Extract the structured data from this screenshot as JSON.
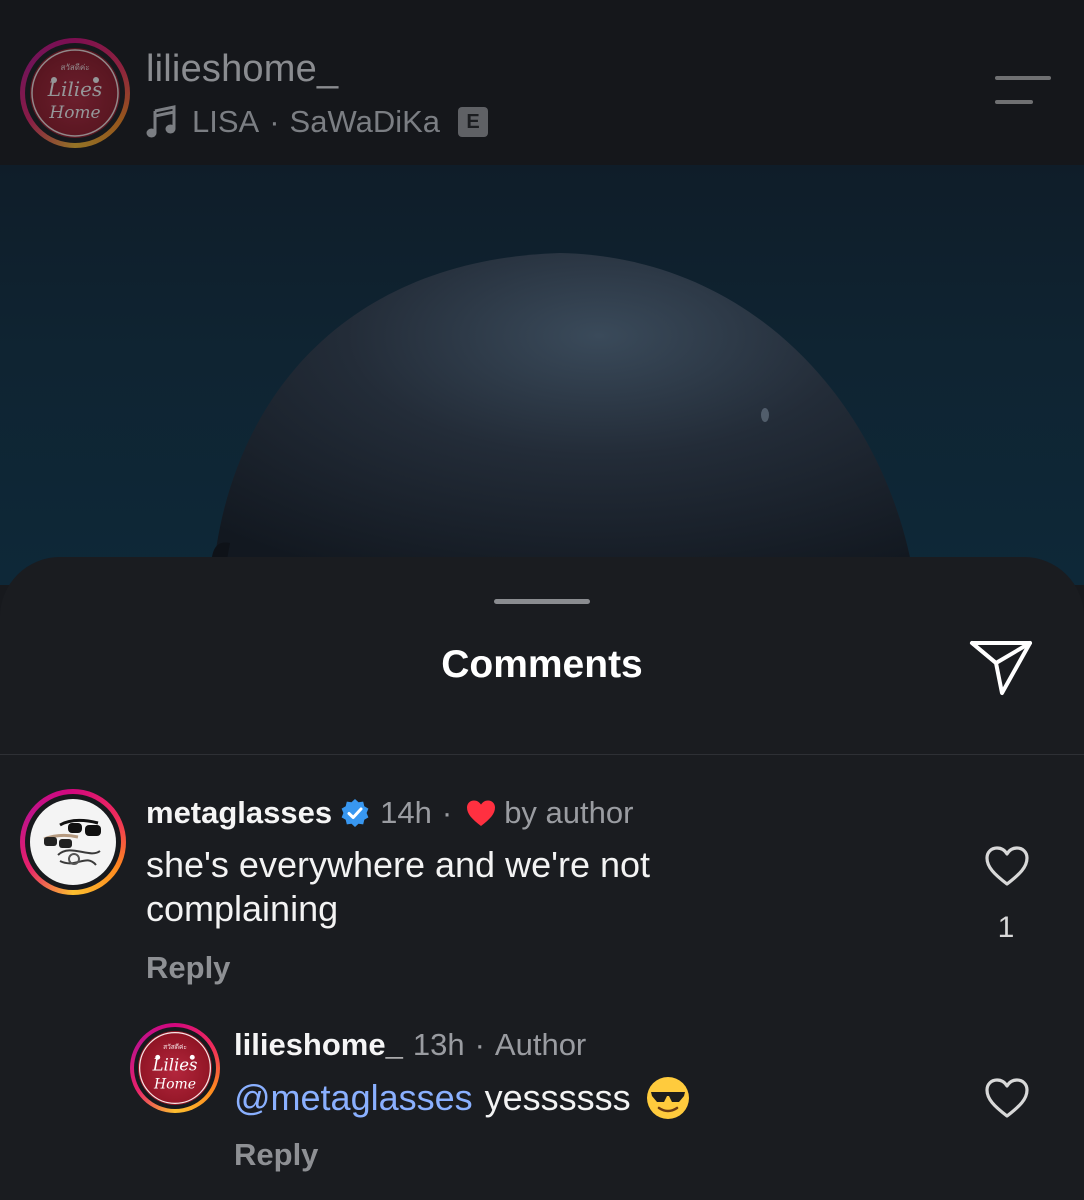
{
  "header": {
    "username": "lilieshome_",
    "music": {
      "artist": "LISA",
      "separator": "·",
      "song": "SaWaDiKa",
      "explicit_badge": "E"
    },
    "avatar_logo_text": "Lilies Home"
  },
  "sheet": {
    "title": "Comments"
  },
  "comments": [
    {
      "username": "metaglasses",
      "verified": true,
      "time": "14h",
      "separator": "·",
      "liked_by_author_label": "by author",
      "text": "she's everywhere and we're not complaining",
      "reply_label": "Reply",
      "like_count": "1"
    }
  ],
  "replies": [
    {
      "username": "lilieshome_",
      "time": "13h",
      "separator": "·",
      "badge": "Author",
      "mention": "@metaglasses",
      "text": "yessssss",
      "reply_label": "Reply"
    }
  ],
  "colors": {
    "mention": "#8ab0ff",
    "verified": "#3897f0",
    "heart_red": "#ff3040",
    "sheet_bg": "#1a1c20"
  }
}
